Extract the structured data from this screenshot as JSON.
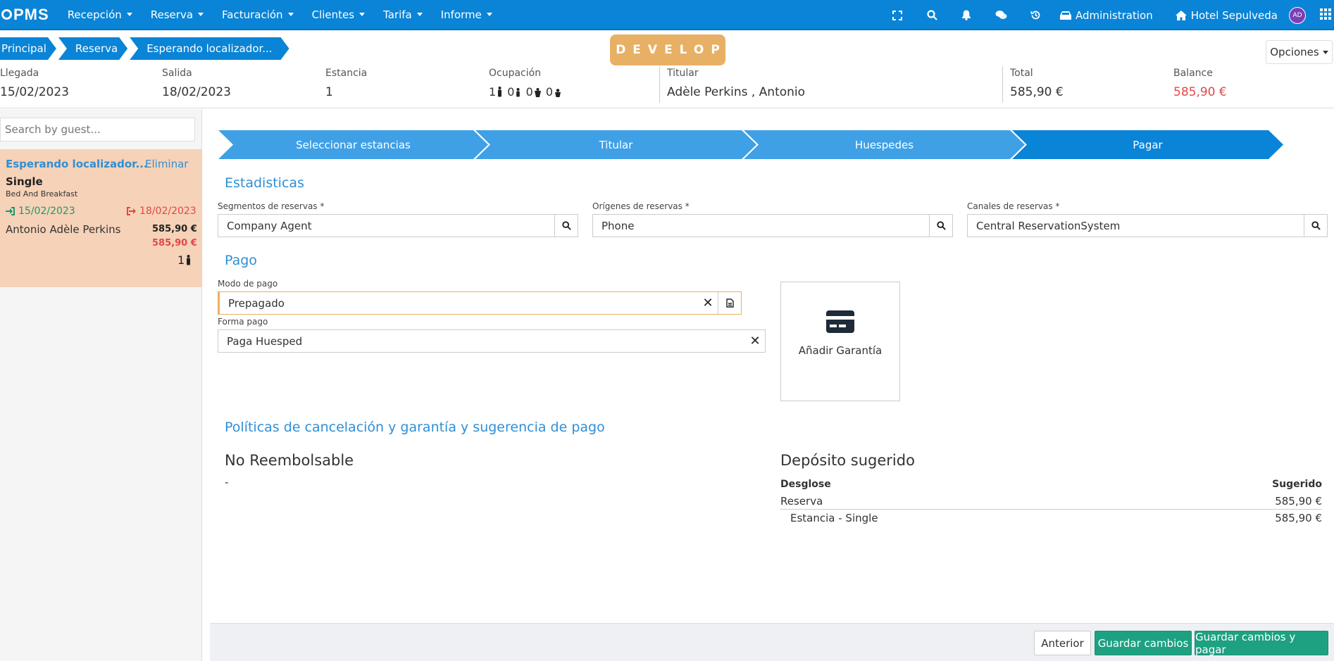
{
  "nav": {
    "logo": "PMS",
    "menu": [
      "Recepción",
      "Reserva",
      "Facturación",
      "Clientes",
      "Tarifa",
      "Informe"
    ],
    "admin_label": "Administration",
    "hotel_label": "Hotel Sepulveda",
    "avatar_initials": "AD"
  },
  "breadcrumb": [
    "Principal",
    "Reserva",
    "Esperando localizador..."
  ],
  "env_badge": "DEVELOP",
  "options_label": "Opciones",
  "summary": {
    "llegada": {
      "label": "Llegada",
      "value": "15/02/2023"
    },
    "salida": {
      "label": "Salida",
      "value": "18/02/2023"
    },
    "estancia": {
      "label": "Estancia",
      "value": "1"
    },
    "ocupacion": {
      "label": "Ocupación",
      "adults": "1",
      "children": "0",
      "extra": "0",
      "babies": "0"
    },
    "titular": {
      "label": "Titular",
      "value": "Adèle Perkins , Antonio"
    },
    "total": {
      "label": "Total",
      "value": "585,90 €"
    },
    "balance": {
      "label": "Balance",
      "value": "585,90 €"
    }
  },
  "left": {
    "search_placeholder": "Search by guest...",
    "card": {
      "title": "Esperando localizador...",
      "delete": "Eliminar",
      "room_type": "Single",
      "board": "Bed And Breakfast",
      "checkin": "15/02/2023",
      "checkout": "18/02/2023",
      "guest": "Antonio Adèle Perkins",
      "amount": "585,90 €",
      "pending": "585,90 €",
      "pax": "1"
    }
  },
  "steps": [
    "Seleccionar estancias",
    "Titular",
    "Huespedes",
    "Pagar"
  ],
  "estadisticas": {
    "title": "Estadisticas",
    "segmentos": {
      "label": "Segmentos de reservas *",
      "value": "Company Agent"
    },
    "origenes": {
      "label": "Orígenes de reservas *",
      "value": "Phone"
    },
    "canales": {
      "label": "Canales de reservas *",
      "value": "Central ReservationSystem"
    }
  },
  "pago": {
    "title": "Pago",
    "modo": {
      "label": "Modo de pago",
      "value": "Prepagado"
    },
    "forma": {
      "label": "Forma pago",
      "value": "Paga Huesped"
    },
    "garantia_label": "Añadir Garantía"
  },
  "politicas": {
    "title": "Políticas de cancelación y garantía y sugerencia de pago",
    "policy_name": "No Reembolsable",
    "policy_desc": "-",
    "deposit_title": "Depósito sugerido",
    "table": {
      "col1": "Desglose",
      "col2": "Sugerido",
      "rows": [
        {
          "label": "Reserva",
          "value": "585,90 €"
        },
        {
          "label": "Estancia - Single",
          "value": "585,90 €"
        }
      ]
    }
  },
  "footer": {
    "anterior": "Anterior",
    "guardar": "Guardar cambios",
    "guardar_pagar": "Guardar cambios y pagar"
  },
  "colors": {
    "primary": "#0a84d6",
    "step": "#3fa0e6",
    "accent": "#e8b065",
    "danger": "#e04848",
    "success": "#1ea181",
    "card": "#f6d2b8"
  }
}
